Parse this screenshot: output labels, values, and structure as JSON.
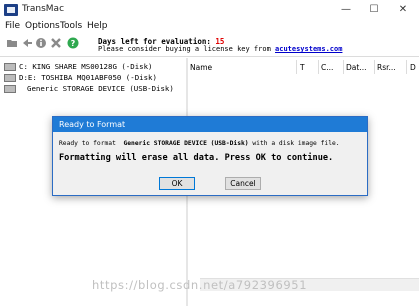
{
  "window": {
    "title": "TransMac",
    "min_icon": "—",
    "max_icon": "☐",
    "close_icon": "✕"
  },
  "menu": [
    "File",
    "Options",
    "Tools",
    "Help"
  ],
  "toolbar_icons": [
    "folder-icon",
    "back-icon",
    "info-icon",
    "delete-icon",
    "help-icon"
  ],
  "evaluation": {
    "days_label": "Days left for evaluation:",
    "days_value": "15",
    "license_text": "Please consider buying a license key from",
    "license_link": "acutesystems.com"
  },
  "drives": [
    "C: KING SHARE MS00128G (-Disk)",
    "D:E: TOSHIBA MQ01ABF050 (-Disk)",
    "Generic STORAGE DEVICE (USB-Disk)"
  ],
  "columns": [
    "Name",
    "T",
    "C...",
    "Dat...",
    "Rsr...",
    "D"
  ],
  "dialog": {
    "title": "Ready to Format",
    "message_prefix": "Ready to format",
    "device_name": "Generic STORAGE DEVICE (USB-Disk)",
    "message_suffix": "with a disk image file.",
    "warning": "Formatting will erase all data. Press OK to continue.",
    "ok_label": "OK",
    "cancel_label": "Cancel"
  },
  "watermark": "https://blog.csdn.net/a792396951"
}
